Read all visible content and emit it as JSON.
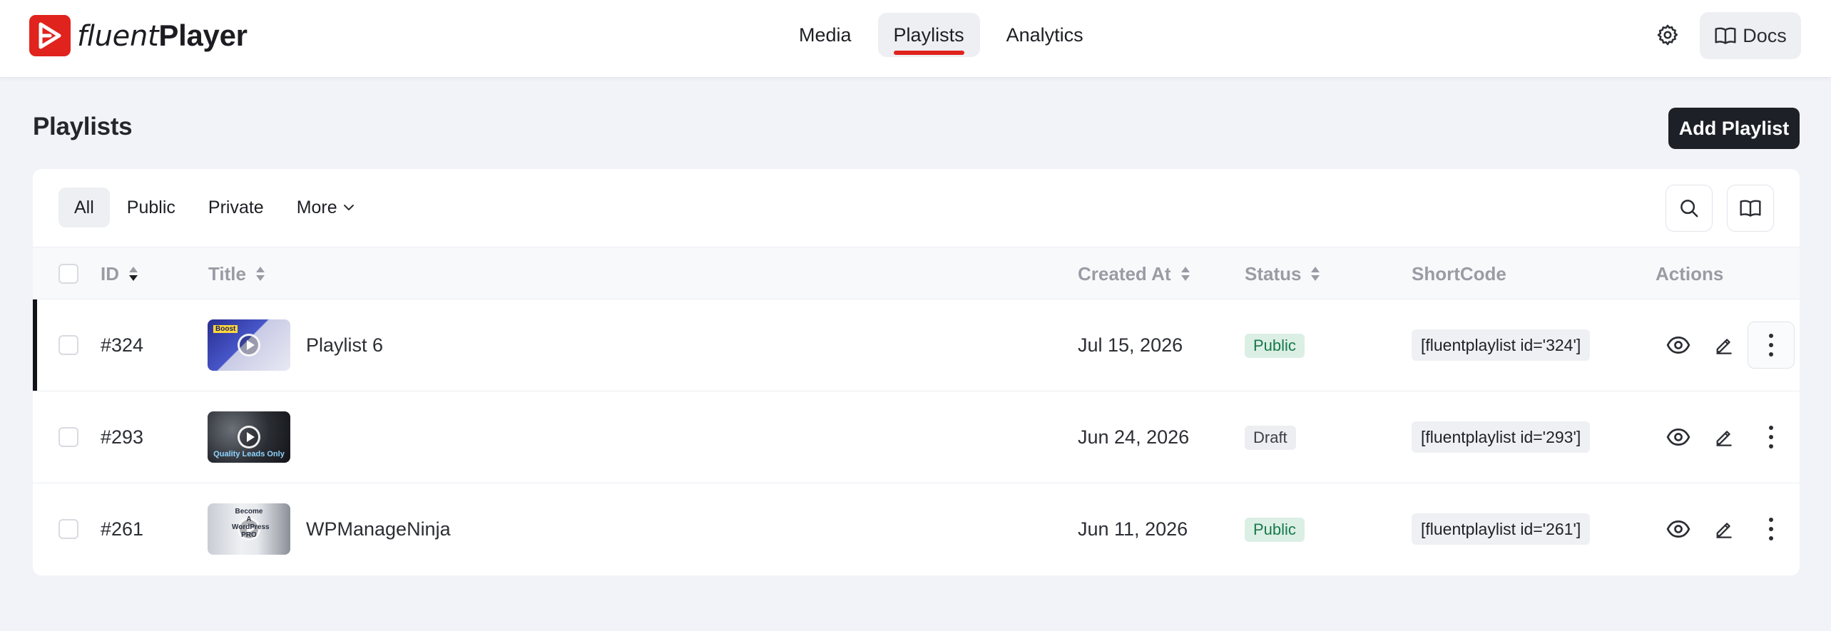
{
  "app": {
    "brand_light": "fluent",
    "brand_bold": "Player"
  },
  "nav": {
    "items": [
      {
        "label": "Media"
      },
      {
        "label": "Playlists",
        "active": true
      },
      {
        "label": "Analytics"
      }
    ],
    "docs_label": "Docs",
    "accent_color": "#e0231c"
  },
  "page": {
    "title": "Playlists",
    "add_button_label": "Add Playlist"
  },
  "filters": {
    "tabs": [
      {
        "label": "All",
        "active": true
      },
      {
        "label": "Public"
      },
      {
        "label": "Private"
      },
      {
        "label": "More"
      }
    ]
  },
  "table": {
    "columns": {
      "id": "ID",
      "title": "Title",
      "created_at": "Created At",
      "status": "Status",
      "shortcode": "ShortCode",
      "actions": "Actions"
    },
    "rows": [
      {
        "id": "#324",
        "title": "Playlist 6",
        "thumb_top_label": "Boost",
        "created_at": "Jul 15, 2026",
        "status": "Public",
        "shortcode": "[fluentplaylist id='324']"
      },
      {
        "id": "#293",
        "title": "",
        "thumb_caption": "Quality Leads Only",
        "created_at": "Jun 24, 2026",
        "status": "Draft",
        "shortcode": "[fluentplaylist id='293']"
      },
      {
        "id": "#261",
        "title": "WPManageNinja",
        "thumb_side_label": "Become A WordPress PRO",
        "created_at": "Jun 11, 2026",
        "status": "Public",
        "shortcode": "[fluentplaylist id='261']"
      }
    ]
  },
  "icons": {
    "gear": "gear-icon",
    "book": "book-icon",
    "search": "search-icon",
    "eye": "eye-icon",
    "pencil": "pencil-icon",
    "kebab": "kebab-icon",
    "chevron": "chevron-down-icon",
    "sort": "sort-icon",
    "play": "play-icon"
  }
}
